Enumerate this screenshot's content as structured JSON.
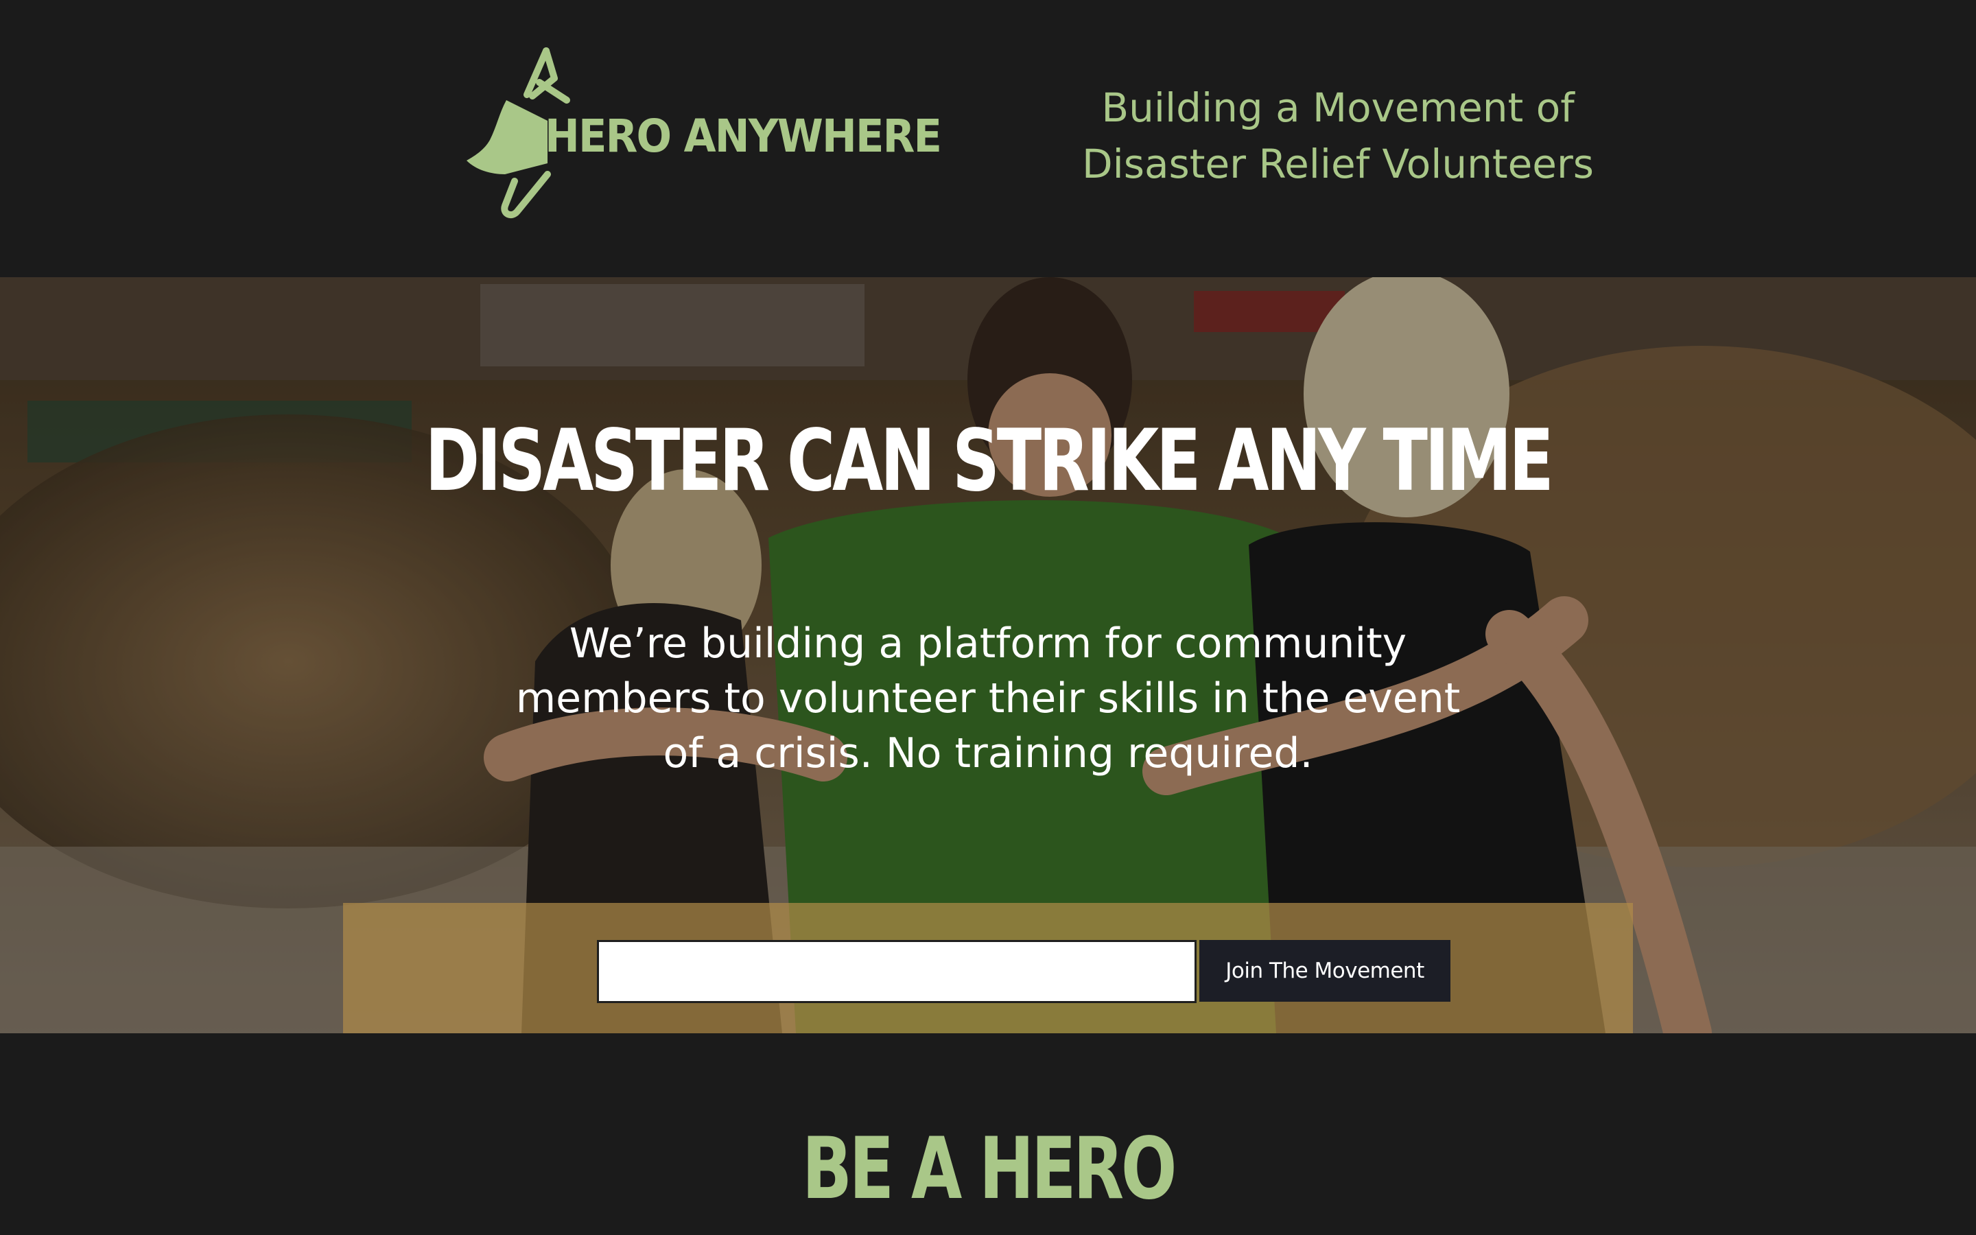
{
  "header": {
    "logo_text": "HERO ANYWHERE",
    "tagline_line1": "Building a Movement of",
    "tagline_line2": "Disaster Relief Volunteers"
  },
  "hero": {
    "title": "DISASTER CAN STRIKE ANY TIME",
    "body": "We’re building a platform for community members to volunteer their skills in the event of a crisis. No training required.",
    "email_value": "",
    "join_label": "Join The Movement"
  },
  "lower": {
    "heading": "BE A HERO"
  },
  "colors": {
    "background": "#1b1b1b",
    "accent_green": "#a9c788",
    "signup_bar": "#b08c48",
    "button_dark": "#1c1e26"
  },
  "icons": {
    "logo_mark": "megaphone-icon"
  }
}
